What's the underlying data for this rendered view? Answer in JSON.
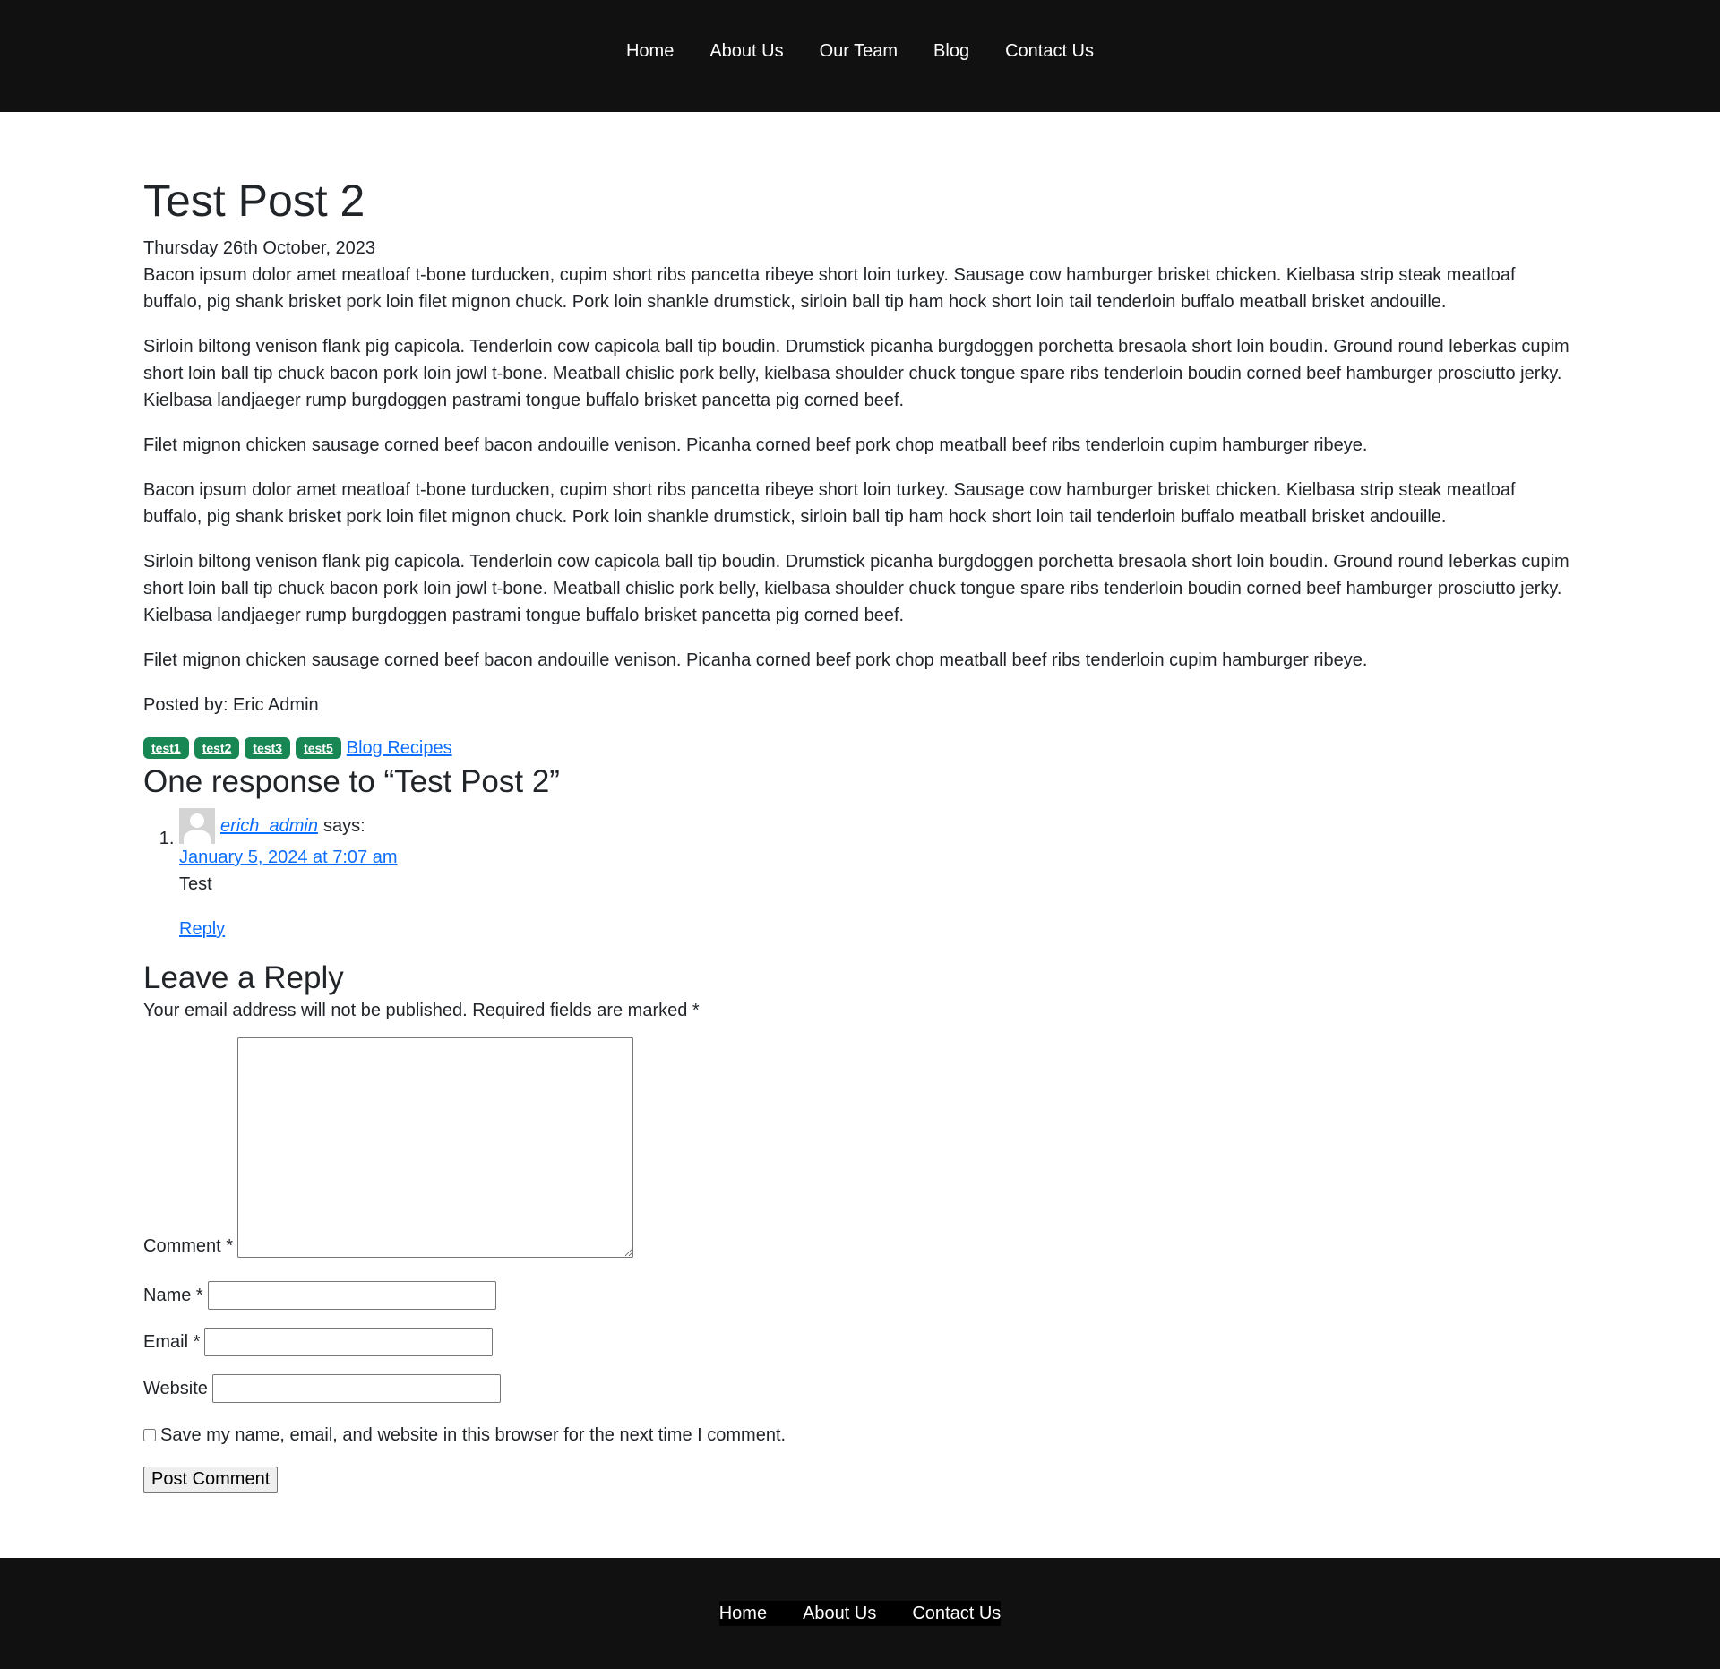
{
  "nav": {
    "items": [
      "Home",
      "About Us",
      "Our Team",
      "Blog",
      "Contact Us"
    ]
  },
  "post": {
    "title": "Test Post 2",
    "date": "Thursday 26th October, 2023",
    "paragraphs": [
      "Bacon ipsum dolor amet meatloaf t-bone turducken, cupim short ribs pancetta ribeye short loin turkey. Sausage cow hamburger brisket chicken. Kielbasa strip steak meatloaf buffalo, pig shank brisket pork loin filet mignon chuck. Pork loin shankle drumstick, sirloin ball tip ham hock short loin tail tenderloin buffalo meatball brisket andouille.",
      "Sirloin biltong venison flank pig capicola. Tenderloin cow capicola ball tip boudin. Drumstick picanha burgdoggen porchetta bresaola short loin boudin. Ground round leberkas cupim short loin ball tip chuck bacon pork loin jowl t-bone. Meatball chislic pork belly, kielbasa shoulder chuck tongue spare ribs tenderloin boudin corned beef hamburger prosciutto jerky. Kielbasa landjaeger rump burgdoggen pastrami tongue buffalo brisket pancetta pig corned beef.",
      "Filet mignon chicken sausage corned beef bacon andouille venison. Picanha corned beef pork chop meatball beef ribs tenderloin cupim hamburger ribeye.",
      "Bacon ipsum dolor amet meatloaf t-bone turducken, cupim short ribs pancetta ribeye short loin turkey. Sausage cow hamburger brisket chicken. Kielbasa strip steak meatloaf buffalo, pig shank brisket pork loin filet mignon chuck. Pork loin shankle drumstick, sirloin ball tip ham hock short loin tail tenderloin buffalo meatball brisket andouille.",
      "Sirloin biltong venison flank pig capicola. Tenderloin cow capicola ball tip boudin. Drumstick picanha burgdoggen porchetta bresaola short loin boudin. Ground round leberkas cupim short loin ball tip chuck bacon pork loin jowl t-bone. Meatball chislic pork belly, kielbasa shoulder chuck tongue spare ribs tenderloin boudin corned beef hamburger prosciutto jerky. Kielbasa landjaeger rump burgdoggen pastrami tongue buffalo brisket pancetta pig corned beef.",
      "Filet mignon chicken sausage corned beef bacon andouille venison. Picanha corned beef pork chop meatball beef ribs tenderloin cupim hamburger ribeye."
    ],
    "posted_by": "Posted by: Eric Admin",
    "tags": [
      "test1",
      "test2",
      "test3",
      "test5"
    ],
    "category": "Blog Recipes",
    "tag_color": "#198754"
  },
  "comments": {
    "heading": "One response to “Test Post 2”",
    "items": [
      {
        "number": "1.",
        "author": "erich_admin",
        "says": "says:",
        "date": "January 5, 2024 at 7:07 am",
        "text": "Test",
        "reply": "Reply",
        "avatar_icon": "default-avatar-icon"
      }
    ]
  },
  "reply_form": {
    "heading": "Leave a Reply",
    "notice": "Your email address will not be published. Required fields are marked *",
    "comment_label": "Comment *",
    "name_label": "Name *",
    "email_label": "Email *",
    "website_label": "Website",
    "comment_value": "",
    "name_value": "",
    "email_value": "",
    "website_value": "",
    "cookies_label": "Save my name, email, and website in this browser for the next time I comment.",
    "cookies_checked": false,
    "submit_label": "Post Comment"
  },
  "footer": {
    "items": [
      "Home",
      "About Us",
      "Contact Us"
    ]
  },
  "colors": {
    "header_bg": "#111111",
    "link": "#0d6efd",
    "text": "#212529"
  }
}
